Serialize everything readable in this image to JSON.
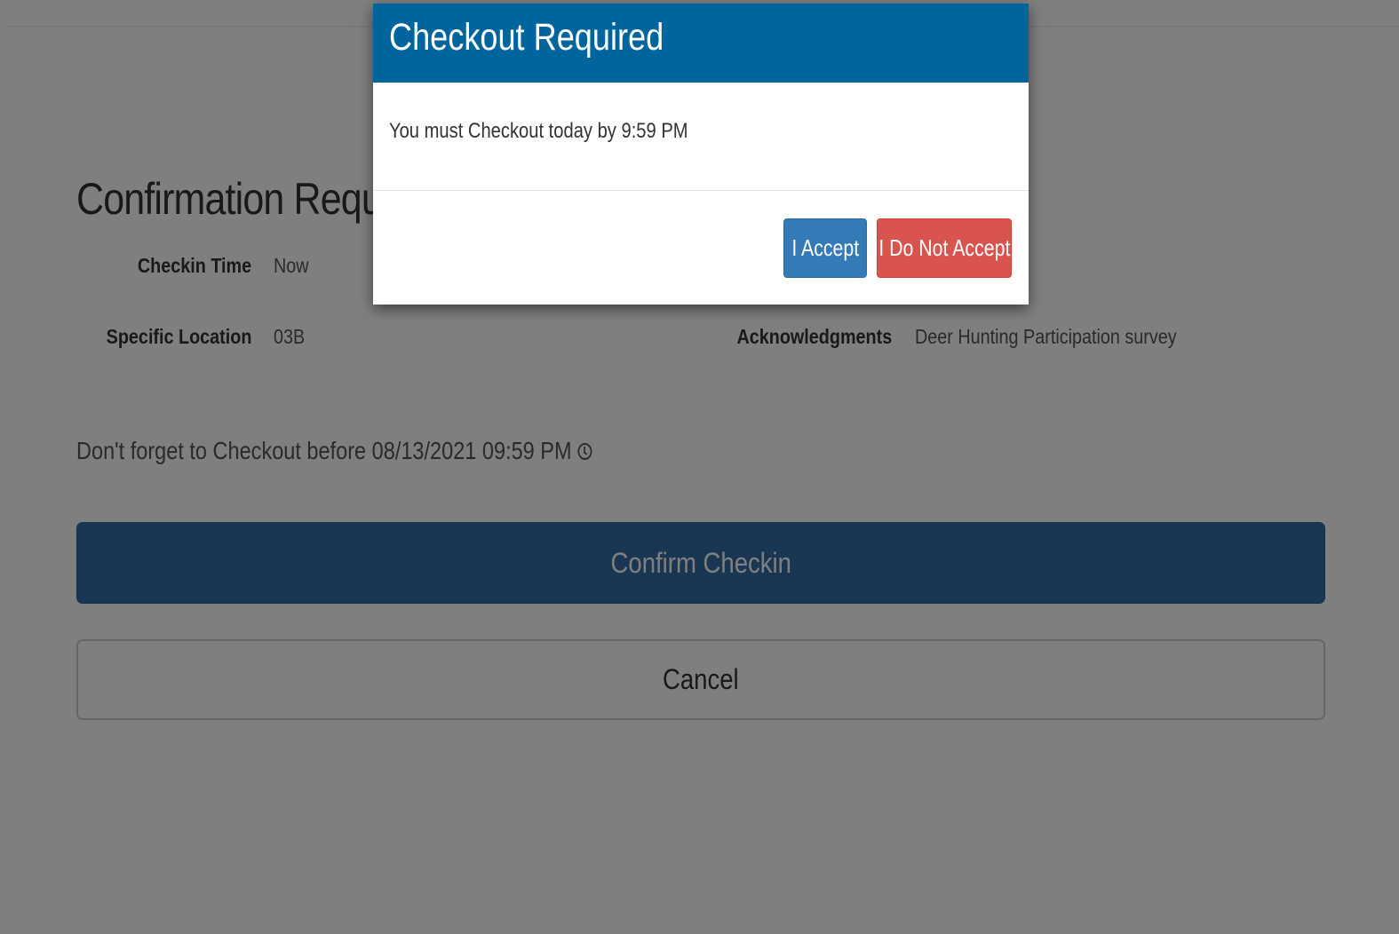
{
  "page": {
    "heading": "Confirmation Required",
    "fields": {
      "checkin_time": {
        "label": "Checkin Time",
        "value": "Now"
      },
      "specific_location": {
        "label": "Specific Location",
        "value": "03B"
      },
      "acknowledgments": {
        "label": "Acknowledgments",
        "value": "Deer Hunting Participation survey"
      }
    },
    "reminder": "Don't forget to Checkout before 08/13/2021 09:59 PM",
    "reminder_icon": "clock-icon",
    "confirm_button": "Confirm Checkin",
    "cancel_button": "Cancel"
  },
  "modal": {
    "title": "Checkout Required",
    "message": "You must Checkout today by 9:59 PM",
    "accept_button": "I Accept",
    "decline_button": "I Do Not Accept"
  },
  "colors": {
    "modal_header": "#00659c",
    "primary_button": "#337ab7",
    "danger_button": "#d9534f",
    "backdrop": "rgba(0,0,0,0.5)"
  }
}
